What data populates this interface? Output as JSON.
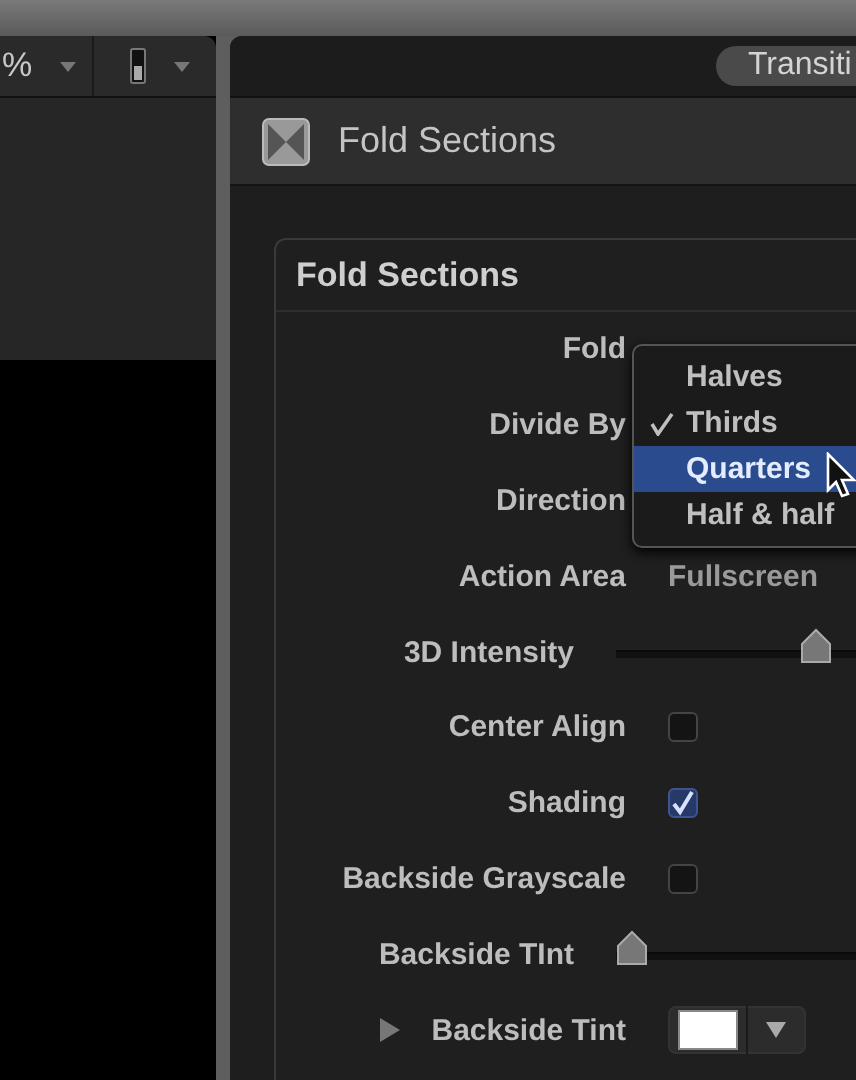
{
  "left_toolbar": {
    "zoom_text": "%"
  },
  "tab": {
    "label": "Transiti",
    "selected": true
  },
  "header": {
    "title": "Fold Sections"
  },
  "group": {
    "title": "Fold Sections",
    "rows": [
      {
        "kind": "popup",
        "label": "Fold"
      },
      {
        "kind": "popup",
        "label": "Divide By"
      },
      {
        "kind": "popup",
        "label": "Direction"
      },
      {
        "kind": "text",
        "label": "Action Area",
        "value": "Fullscreen"
      },
      {
        "kind": "slider",
        "label": "3D Intensity",
        "level": 0.88
      },
      {
        "kind": "checkbox",
        "label": "Center Align",
        "checked": false
      },
      {
        "kind": "checkbox",
        "label": "Shading",
        "checked": true
      },
      {
        "kind": "checkbox",
        "label": "Backside Grayscale",
        "checked": false
      },
      {
        "kind": "slider",
        "label": "Backside TInt",
        "level": 0
      },
      {
        "kind": "color",
        "label": "Backside Tint",
        "expanded": false,
        "color": "#ffffff"
      }
    ]
  },
  "menu": {
    "items": [
      {
        "label": "Halves",
        "checked": false,
        "selected": false
      },
      {
        "label": "Thirds",
        "checked": true,
        "selected": false
      },
      {
        "label": "Quarters",
        "checked": false,
        "selected": true
      },
      {
        "label": "Half & half",
        "checked": false,
        "selected": false
      }
    ]
  }
}
